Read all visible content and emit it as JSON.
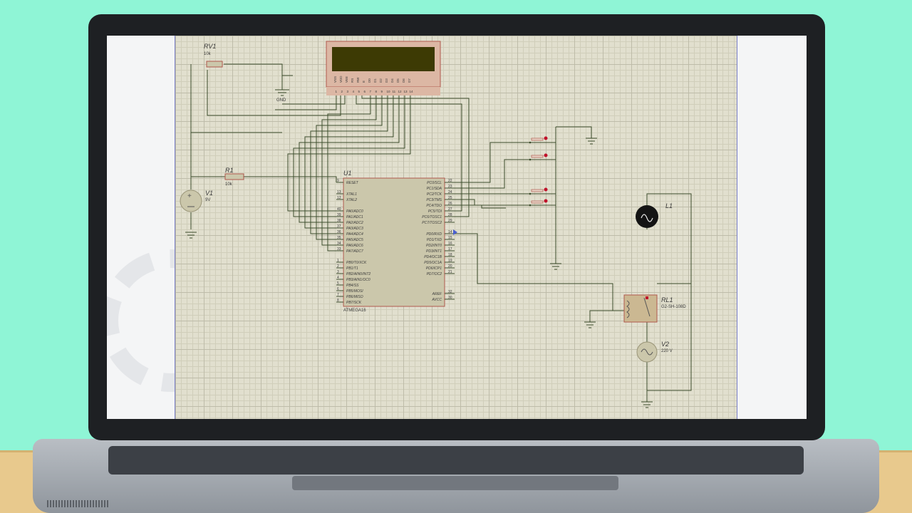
{
  "schematic": {
    "rv1": {
      "ref": "RV1",
      "value": "10k"
    },
    "gnd_label": "GND",
    "r1": {
      "ref": "R1",
      "value": "10k"
    },
    "v1": {
      "ref": "V1",
      "value": "9V"
    },
    "u1": {
      "ref": "U1",
      "part": "ATMEGA16",
      "left_pins": [
        {
          "num": "9",
          "name": "RESET"
        },
        {
          "num": "13",
          "name": "XTAL1"
        },
        {
          "num": "12",
          "name": "XTAL2"
        },
        {
          "num": "40",
          "name": "PA0/ADC0"
        },
        {
          "num": "39",
          "name": "PA1/ADC1"
        },
        {
          "num": "38",
          "name": "PA2/ADC2"
        },
        {
          "num": "37",
          "name": "PA3/ADC3"
        },
        {
          "num": "36",
          "name": "PA4/ADC4"
        },
        {
          "num": "35",
          "name": "PA5/ADC5"
        },
        {
          "num": "34",
          "name": "PA6/ADC6"
        },
        {
          "num": "33",
          "name": "PA7/ADC7"
        },
        {
          "num": "1",
          "name": "PB0/T0/XCK"
        },
        {
          "num": "2",
          "name": "PB1/T1"
        },
        {
          "num": "3",
          "name": "PB2/AIN0/INT2"
        },
        {
          "num": "4",
          "name": "PB3/AIN1/OC0"
        },
        {
          "num": "5",
          "name": "PB4/SS"
        },
        {
          "num": "6",
          "name": "PB5/MOSI"
        },
        {
          "num": "7",
          "name": "PB6/MISO"
        },
        {
          "num": "8",
          "name": "PB7/SCK"
        }
      ],
      "right_pins": [
        {
          "num": "22",
          "name": "PC0/SCL"
        },
        {
          "num": "23",
          "name": "PC1/SDA"
        },
        {
          "num": "24",
          "name": "PC2/TCK"
        },
        {
          "num": "25",
          "name": "PC3/TMS"
        },
        {
          "num": "26",
          "name": "PC4/TDO"
        },
        {
          "num": "27",
          "name": "PC5/TDI"
        },
        {
          "num": "28",
          "name": "PC6/TOSC1"
        },
        {
          "num": "29",
          "name": "PC7/TOSC2"
        },
        {
          "num": "14",
          "name": "PD0/RXD"
        },
        {
          "num": "15",
          "name": "PD1/TXD"
        },
        {
          "num": "16",
          "name": "PD2/INT0"
        },
        {
          "num": "17",
          "name": "PD3/INT1"
        },
        {
          "num": "18",
          "name": "PD4/OC1B"
        },
        {
          "num": "19",
          "name": "PD5/OC1A"
        },
        {
          "num": "20",
          "name": "PD6/ICP1"
        },
        {
          "num": "21",
          "name": "PD7/OC2"
        },
        {
          "num": "32",
          "name": "AREF"
        },
        {
          "num": "30",
          "name": "AVCC"
        }
      ]
    },
    "lcd": {
      "pin_labels": [
        "VSS",
        "VDD",
        "VEE",
        "RS",
        "RW",
        "E",
        "D0",
        "D1",
        "D2",
        "D3",
        "D4",
        "D5",
        "D6",
        "D7"
      ],
      "pin_numbers": [
        "1",
        "2",
        "3",
        "4",
        "5",
        "6",
        "7",
        "8",
        "9",
        "10",
        "11",
        "12",
        "13",
        "14"
      ]
    },
    "l1": {
      "ref": "L1"
    },
    "rl1": {
      "ref": "RL1",
      "part": "G2-SH-108D"
    },
    "v2": {
      "ref": "V2",
      "value": "220 V"
    },
    "colors": {
      "sheet": "#e1dfce",
      "wire": "#3a4b2a",
      "component_fill": "#cbc7ab",
      "component_border": "#b05a4e",
      "lcd_display": "#3d3a04",
      "lcd_body": "#dcb7a4",
      "pin_marker": "#c0112a"
    }
  }
}
